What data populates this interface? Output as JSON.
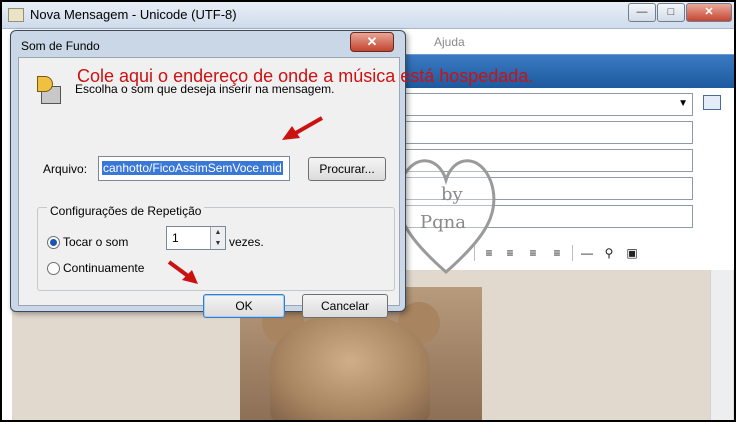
{
  "window": {
    "title": "Nova Mensagem - Unicode (UTF-8)",
    "min_glyph": "—",
    "max_glyph": "□",
    "close_glyph": "✕"
  },
  "menubar": {
    "visible_item": "Ajuda"
  },
  "dialog": {
    "title": "Som de Fundo",
    "close_glyph": "✕",
    "prompt": "Escolha o som que deseja inserir na mensagem.",
    "annotation": "Cole aqui o endereço de onde a música está hospedada.",
    "file_label": "Arquivo:",
    "file_value": "canhotto/FicoAssimSemVoce.mid",
    "browse_button": "Procurar...",
    "repeat_group": "Configurações de Repetição",
    "radio_times": "Tocar o som",
    "times_value": "1",
    "times_suffix": "vezes.",
    "radio_continuous": "Continuamente",
    "ok_button": "OK",
    "cancel_button": "Cancelar"
  },
  "watermark": {
    "line1": "by",
    "line2": "Pqna"
  },
  "colors": {
    "annotation": "#cc1111",
    "accent": "#1d5aa0",
    "selection": "#3a78d8"
  },
  "icons": [
    "speaker-icon",
    "address-book-icon",
    "align-left-icon",
    "align-center-icon",
    "align-right-icon",
    "justify-icon",
    "horizontal-line-icon",
    "insert-image-icon"
  ]
}
